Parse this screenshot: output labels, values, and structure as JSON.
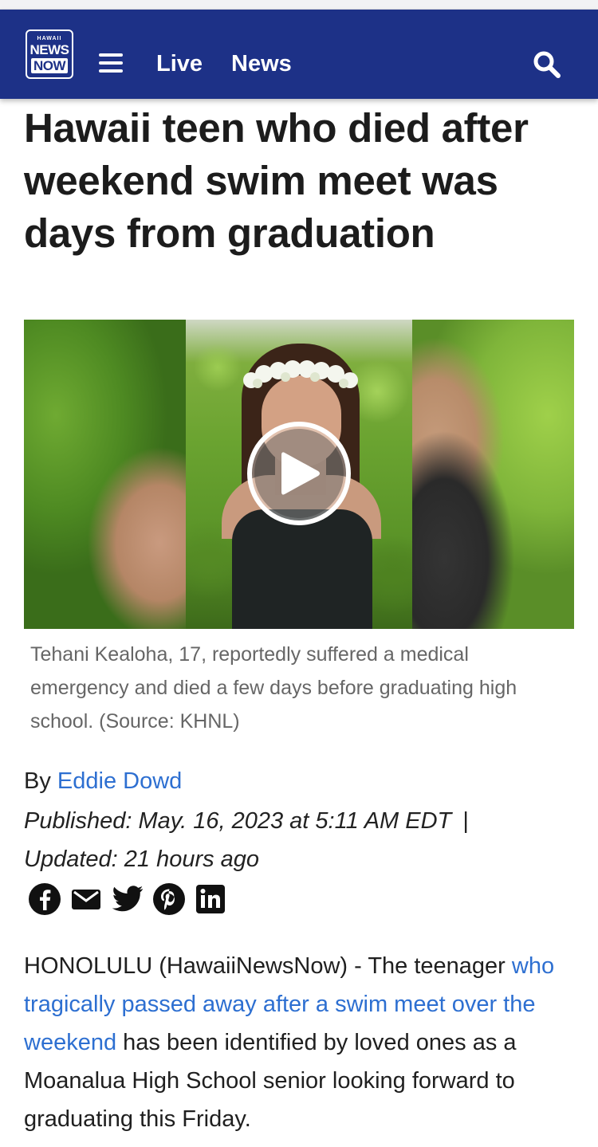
{
  "header": {
    "logo": {
      "line1": "HAWAII",
      "line2": "NEWS",
      "line3": "NOW"
    },
    "nav": [
      {
        "label": "Live"
      },
      {
        "label": "News"
      }
    ]
  },
  "article": {
    "headline": "Hawaii teen who died after weekend swim meet was days from graduation",
    "caption": "Tehani Kealoha, 17, reportedly suffered a medical emergency and died a few days before graduating high school. (Source: KHNL)",
    "byline_prefix": "By",
    "author": "Eddie Dowd",
    "published": "Published: May. 16, 2023 at 5:11 AM EDT",
    "separator": "|",
    "updated": "Updated: 21 hours ago",
    "share_icons": [
      "facebook-icon",
      "email-icon",
      "twitter-icon",
      "pinterest-icon",
      "linkedin-icon"
    ],
    "body": {
      "intro": "HONOLULU (HawaiiNewsNow) - The teenager ",
      "link": "who tragically passed away after a swim meet over the weekend",
      "rest": " has been identified by loved ones as a Moanalua High School senior looking forward to graduating this Friday."
    }
  },
  "colors": {
    "header_bg": "#1d3187",
    "link": "#2d6fd1",
    "caption": "#666666"
  }
}
